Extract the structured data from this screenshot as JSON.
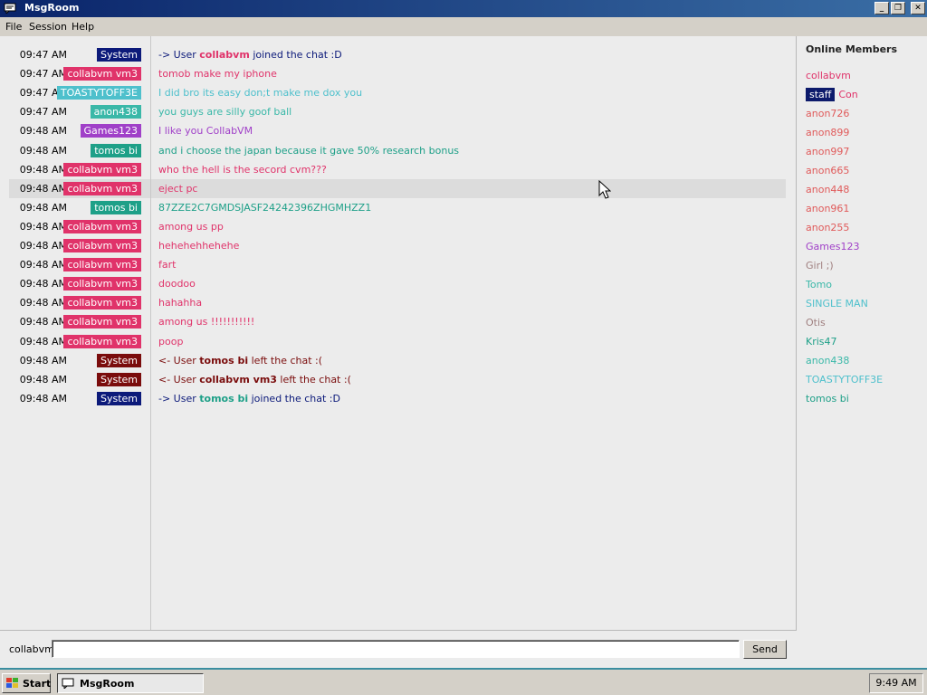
{
  "window": {
    "title": "MsgRoom"
  },
  "menu": [
    "File",
    "Session",
    "Help"
  ],
  "colors": {
    "system_badge": "#0c1a7a",
    "system_leave_badge": "#7a0c0c",
    "collabvm_vm3": "#e0336a",
    "toastytoff3e": "#4ec0cc",
    "anon438": "#3ab8a8",
    "games123": "#a040c8",
    "tomos_bi": "#1ea088"
  },
  "messages": [
    {
      "time": "09:47 AM",
      "user": "System",
      "badge_color": "#0c1a7a",
      "prefix": "-> User ",
      "bold": "collabvm",
      "suffix": " joined the chat :D",
      "text_color": "#0c1a7a",
      "bold_color": "#e0336a"
    },
    {
      "time": "09:47 AM",
      "user": "collabvm vm3",
      "badge_color": "#e0336a",
      "text": "tomob make my iphone",
      "text_color": "#e0336a"
    },
    {
      "time": "09:47 AM",
      "user": "TOASTYTOFF3E",
      "badge_color": "#4ec0cc",
      "text": "I did bro its easy don;t make me dox you",
      "text_color": "#4ec0cc"
    },
    {
      "time": "09:47 AM",
      "user": "anon438",
      "badge_color": "#3ab8a8",
      "text": "you guys are silly goof ball",
      "text_color": "#3ab8a8"
    },
    {
      "time": "09:48 AM",
      "user": "Games123",
      "badge_color": "#a040c8",
      "text": "I like you CollabVM",
      "text_color": "#a040c8"
    },
    {
      "time": "09:48 AM",
      "user": "tomos bi",
      "badge_color": "#1ea088",
      "text": "and i choose the japan because it gave 50% research bonus",
      "text_color": "#1ea088"
    },
    {
      "time": "09:48 AM",
      "user": "collabvm vm3",
      "badge_color": "#e0336a",
      "text": "who the hell is the secord cvm???",
      "text_color": "#e0336a"
    },
    {
      "time": "09:48 AM",
      "user": "collabvm vm3",
      "badge_color": "#e0336a",
      "text": "eject pc",
      "text_color": "#e0336a",
      "highlight": true
    },
    {
      "time": "09:48 AM",
      "user": "tomos bi",
      "badge_color": "#1ea088",
      "text": "87ZZE2C7GMDSJASF24242396ZHGMHZZ1",
      "text_color": "#1ea088"
    },
    {
      "time": "09:48 AM",
      "user": "collabvm vm3",
      "badge_color": "#e0336a",
      "text": "among us pp",
      "text_color": "#e0336a"
    },
    {
      "time": "09:48 AM",
      "user": "collabvm vm3",
      "badge_color": "#e0336a",
      "text": "hehehehhehehe",
      "text_color": "#e0336a"
    },
    {
      "time": "09:48 AM",
      "user": "collabvm vm3",
      "badge_color": "#e0336a",
      "text": "fart",
      "text_color": "#e0336a"
    },
    {
      "time": "09:48 AM",
      "user": "collabvm vm3",
      "badge_color": "#e0336a",
      "text": "doodoo",
      "text_color": "#e0336a"
    },
    {
      "time": "09:48 AM",
      "user": "collabvm vm3",
      "badge_color": "#e0336a",
      "text": "hahahha",
      "text_color": "#e0336a"
    },
    {
      "time": "09:48 AM",
      "user": "collabvm vm3",
      "badge_color": "#e0336a",
      "text": "among us !!!!!!!!!!!",
      "text_color": "#e0336a"
    },
    {
      "time": "09:48 AM",
      "user": "collabvm vm3",
      "badge_color": "#e0336a",
      "text": "poop",
      "text_color": "#e0336a"
    },
    {
      "time": "09:48 AM",
      "user": "System",
      "badge_color": "#7a0c0c",
      "prefix": "<- User ",
      "bold": "tomos bi",
      "suffix": " left the chat :(",
      "text_color": "#7a0c0c",
      "bold_color": "#7a0c0c"
    },
    {
      "time": "09:48 AM",
      "user": "System",
      "badge_color": "#7a0c0c",
      "prefix": "<- User ",
      "bold": "collabvm vm3",
      "suffix": " left the chat :(",
      "text_color": "#7a0c0c",
      "bold_color": "#7a0c0c"
    },
    {
      "time": "09:48 AM",
      "user": "System",
      "badge_color": "#0c1a7a",
      "prefix": "-> User ",
      "bold": "tomos bi",
      "suffix": " joined the chat :D",
      "text_color": "#0c1a7a",
      "bold_color": "#1ea088"
    }
  ],
  "sidebar": {
    "title": "Online Members",
    "members": [
      {
        "name": "collabvm",
        "color": "#e0336a"
      },
      {
        "name": "Con",
        "color": "#e0336a",
        "staff": "staff"
      },
      {
        "name": "anon726",
        "color": "#e05a5a"
      },
      {
        "name": "anon899",
        "color": "#e05a5a"
      },
      {
        "name": "anon997",
        "color": "#e05a5a"
      },
      {
        "name": "anon665",
        "color": "#e05a5a"
      },
      {
        "name": "anon448",
        "color": "#e05a5a"
      },
      {
        "name": "anon961",
        "color": "#e05a5a"
      },
      {
        "name": "anon255",
        "color": "#e05a5a"
      },
      {
        "name": "Games123",
        "color": "#a040c8"
      },
      {
        "name": "Girl ;)",
        "color": "#a08080"
      },
      {
        "name": "Tomo",
        "color": "#3ab8a8"
      },
      {
        "name": "SINGLE MAN",
        "color": "#4ec0cc"
      },
      {
        "name": "Otis",
        "color": "#a08080"
      },
      {
        "name": "Kris47",
        "color": "#1ea088"
      },
      {
        "name": "anon438",
        "color": "#3ab8a8"
      },
      {
        "name": "TOASTYTOFF3E",
        "color": "#4ec0cc"
      },
      {
        "name": "tomos bi",
        "color": "#1ea088"
      }
    ]
  },
  "input": {
    "nick": "collabvm",
    "value": "",
    "send_label": "Send"
  },
  "taskbar": {
    "start_label": "Start",
    "task_label": "MsgRoom",
    "clock": "9:49 AM"
  }
}
